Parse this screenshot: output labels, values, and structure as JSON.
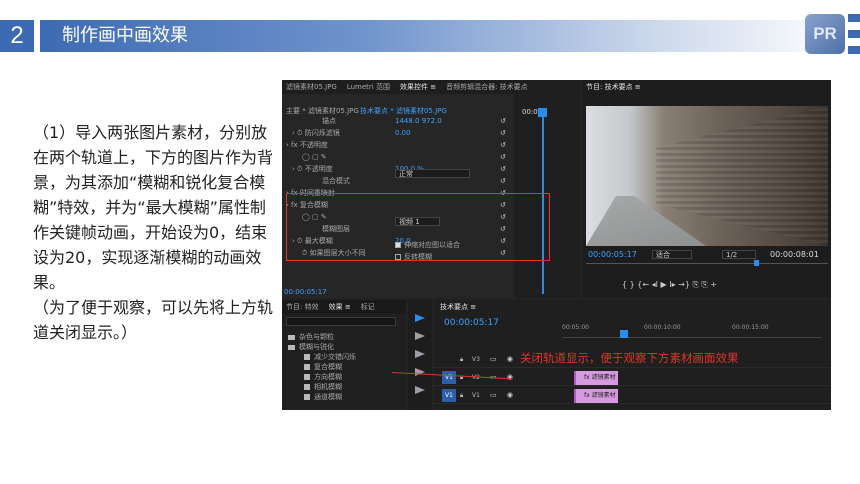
{
  "slide": {
    "number": "2",
    "title": "制作画中画效果",
    "logo_text": "PR"
  },
  "description": {
    "paragraph1": "（1）导入两张图片素材，分别放在两个轨道上，下方的图片作为背景，为其添加“模糊和锐化复合模糊”特效，并为“最大模糊”属性制作关键帧动画，开始设为0，结束设为20，实现逐渐模糊的动画效果。",
    "paragraph2": "（为了便于观察，可以先将上方轨道关闭显示。）"
  },
  "premiere": {
    "top_tabs": [
      "滤镜素材05.JPG",
      "Lumetri 范围",
      "效果控件 ≡",
      "音频剪辑混合器: 技术要点"
    ],
    "ec_header_left": "主要 * 滤镜素材05.JPG",
    "ec_header_right": "技术要点 * 滤镜素材05.JPG",
    "ec_rows": [
      {
        "indent": 40,
        "label": "锚点",
        "value": "1448.0    972.0"
      },
      {
        "indent": 10,
        "label": "› ⏱ 防闪烁滤镜",
        "value": "0.00"
      },
      {
        "indent": 4,
        "label": "› fx 不透明度",
        "value": ""
      },
      {
        "indent": 20,
        "label": "◯ ▢ ✎",
        "value": ""
      },
      {
        "indent": 10,
        "label": "› ⏱ 不透明度",
        "value": "100.0 %"
      },
      {
        "indent": 40,
        "label": "混合模式",
        "value": ""
      },
      {
        "indent": 4,
        "label": "› fx 时间重映射",
        "value": ""
      },
      {
        "indent": 4,
        "label": "› fx 复合模糊",
        "value": ""
      },
      {
        "indent": 20,
        "label": "◯ ▢ ✎",
        "value": ""
      },
      {
        "indent": 40,
        "label": "模糊图层",
        "value": ""
      },
      {
        "indent": 10,
        "label": "› ⏱ 最大模糊",
        "value": "20.0"
      },
      {
        "indent": 20,
        "label": "⏱ 如果图层大小不同",
        "value": ""
      }
    ],
    "blend_mode": "正常",
    "blur_layer": "视频 1",
    "stretch_option": "伸缩对应图以适合",
    "invert_option": "反转模糊",
    "ec_time": "00:00",
    "ec_footer_time": "00:00:05:17",
    "program_title": "节目: 技术要点 ≡",
    "program_time_left": "00:00:05:17",
    "program_fit": "适合",
    "program_scale": "1/2",
    "program_time_right": "00:00:08:01",
    "playback_controls": "{  }  {←  ◂I  ▶  I▸  →}  ⎘  ⎘  +",
    "project_tabs": [
      "节目: 特效",
      "效果 ≡",
      "标记"
    ],
    "effects_tree": [
      {
        "type": "folder",
        "label": "杂色与颗粒",
        "indent": 6
      },
      {
        "type": "folder",
        "label": "模糊与锐化",
        "indent": 6
      },
      {
        "type": "effect",
        "label": "减少交错闪烁",
        "indent": 22
      },
      {
        "type": "effect",
        "label": "复合模糊",
        "indent": 22
      },
      {
        "type": "effect",
        "label": "方向模糊",
        "indent": 22
      },
      {
        "type": "effect",
        "label": "相机模糊",
        "indent": 22
      },
      {
        "type": "effect",
        "label": "通道模糊",
        "indent": 22
      }
    ],
    "timeline_title": "技术要点 ≡",
    "timeline_time": "00:00:05:17",
    "ruler_marks": [
      "00:05:00",
      "00:00:10:00",
      "00:00:15:00"
    ],
    "tracks": [
      {
        "name": "V3",
        "src": ""
      },
      {
        "name": "V2",
        "src": "V1"
      },
      {
        "name": "V1",
        "src": "V1"
      }
    ],
    "clips": [
      {
        "label": "fx 滤镜素材05.JPG"
      },
      {
        "label": "fx 滤镜素材05.JPG"
      }
    ],
    "annotation": "关闭轨道显示，便于观察下方素材画面效果"
  }
}
